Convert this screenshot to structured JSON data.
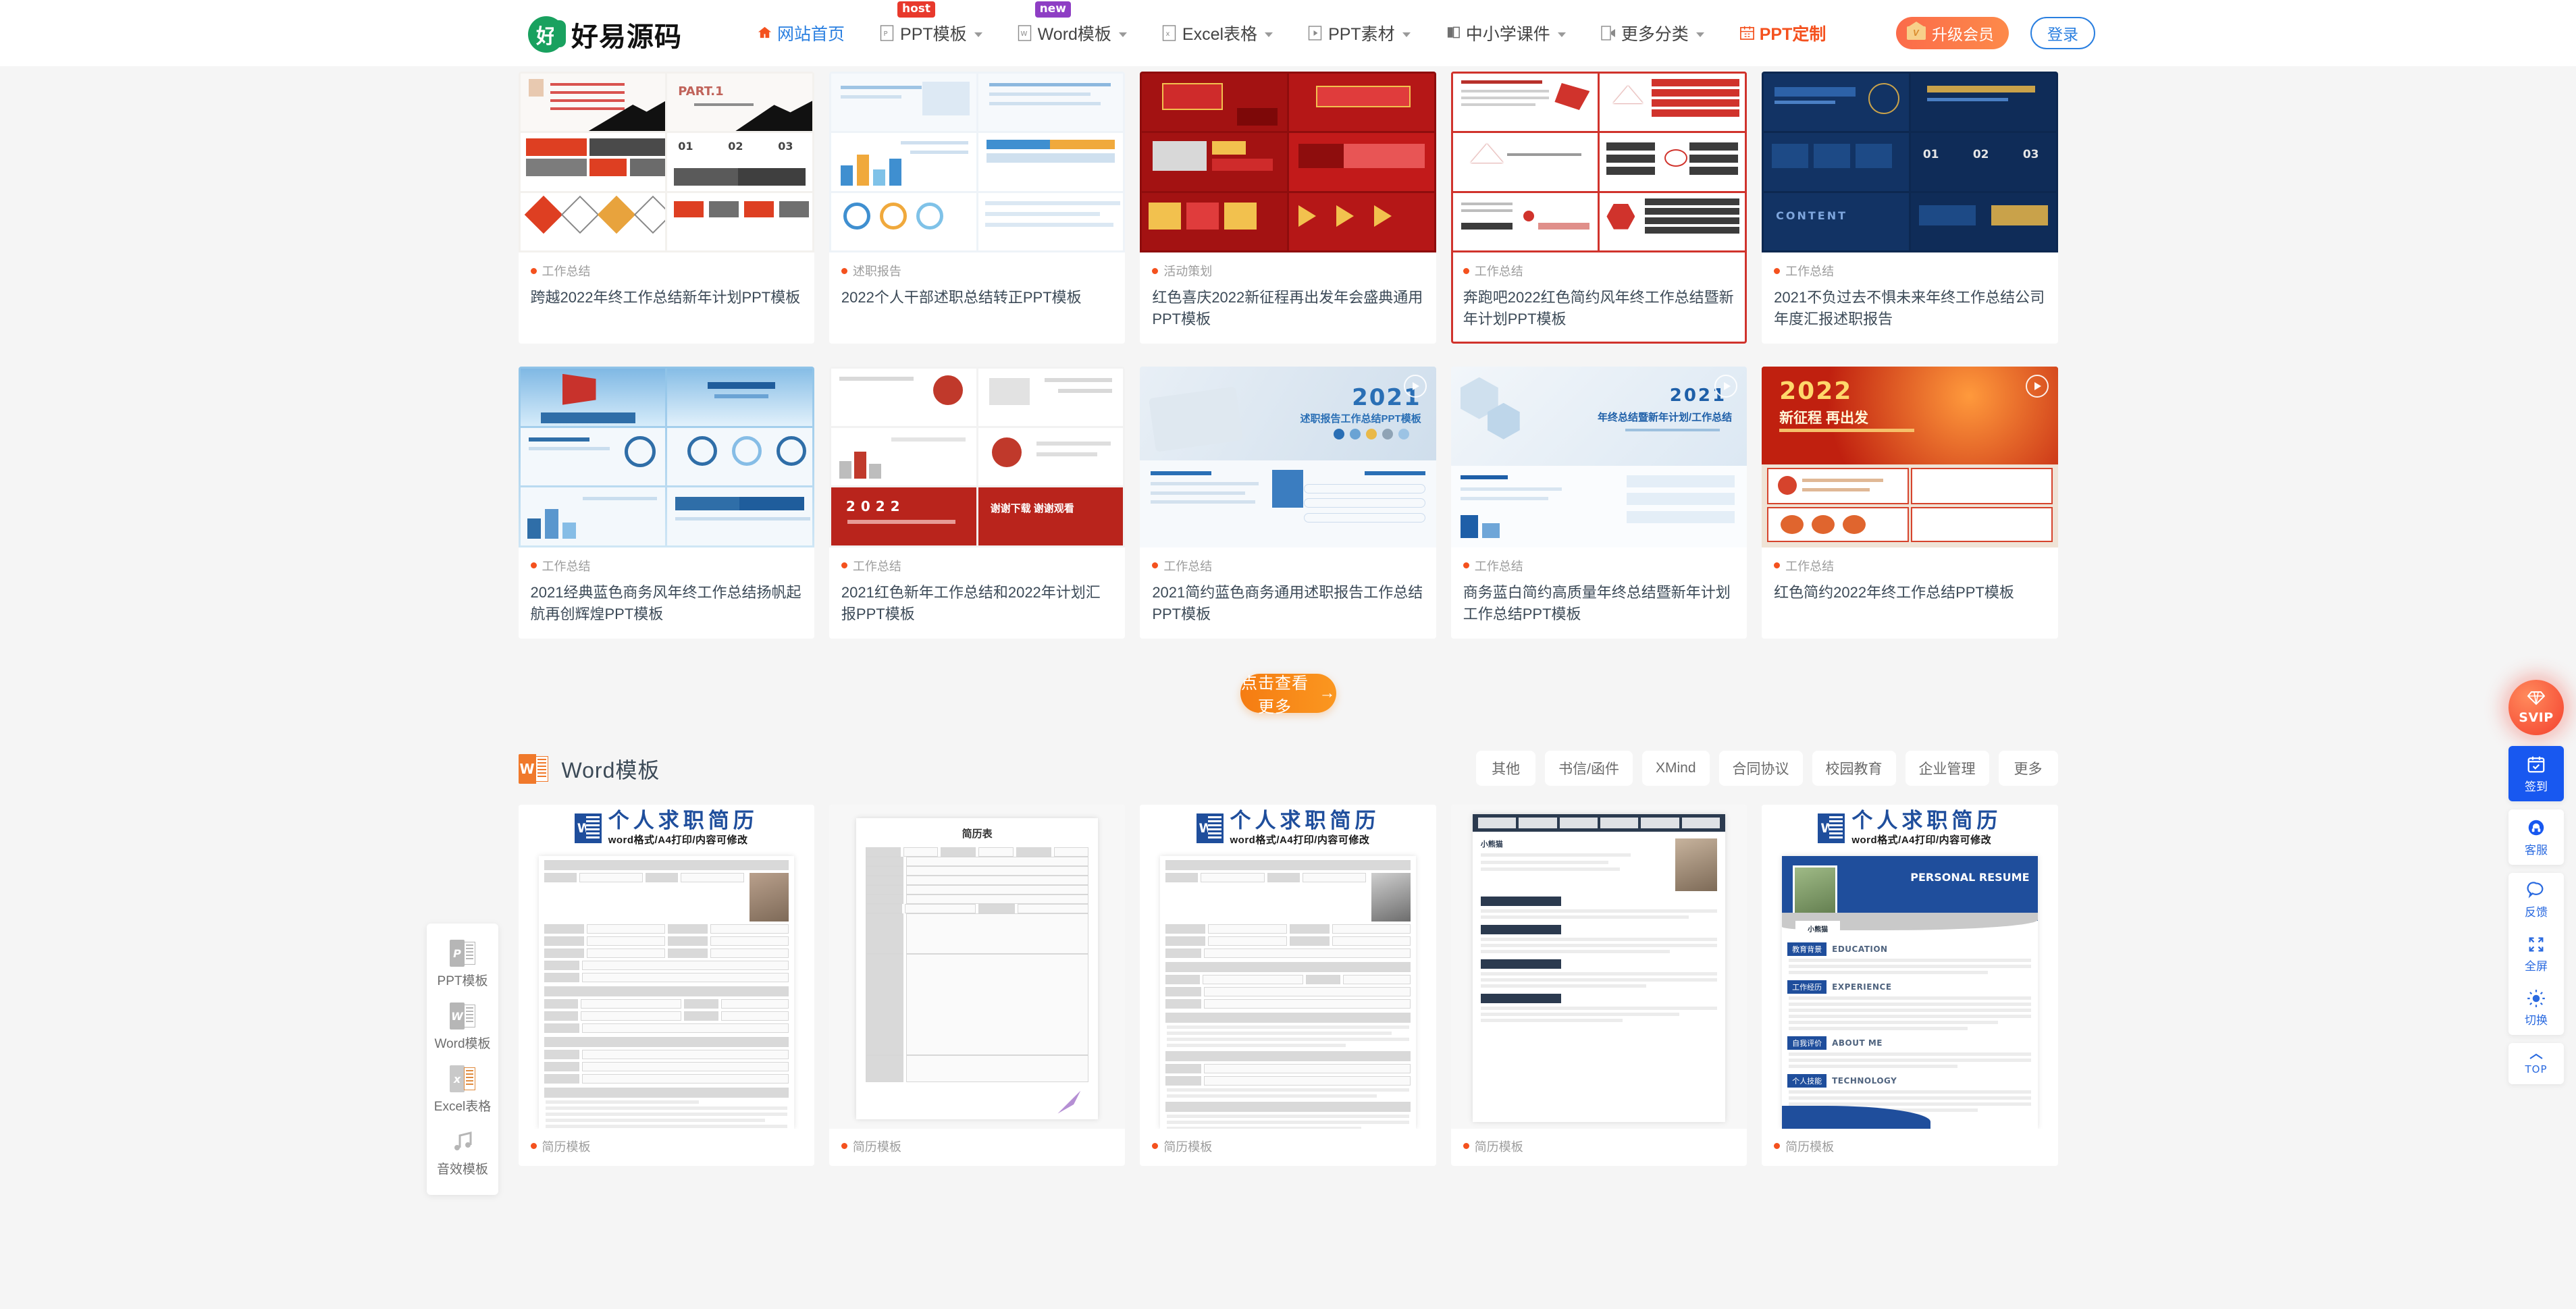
{
  "header": {
    "logo_text": "好易源码",
    "logo_mark": "logo-icon",
    "nav": [
      {
        "label": "网站首页",
        "icon": "home-icon",
        "badge": null,
        "caret": false,
        "active": true,
        "accent": false
      },
      {
        "label": "PPT模板",
        "icon": "ppt-file-icon",
        "badge": "host",
        "badge_type": "host",
        "caret": true,
        "active": false,
        "accent": false
      },
      {
        "label": "Word模板",
        "icon": "word-file-icon",
        "badge": "new",
        "badge_type": "new",
        "caret": true,
        "active": false,
        "accent": false
      },
      {
        "label": "Excel表格",
        "icon": "excel-file-icon",
        "badge": null,
        "caret": true,
        "active": false,
        "accent": false
      },
      {
        "label": "PPT素材",
        "icon": "media-file-icon",
        "badge": null,
        "caret": true,
        "active": false,
        "accent": false
      },
      {
        "label": "中小学课件",
        "icon": "book-icon",
        "badge": null,
        "caret": true,
        "active": false,
        "accent": false
      },
      {
        "label": "更多分类",
        "icon": "more-file-icon",
        "badge": null,
        "caret": true,
        "active": false,
        "accent": false
      },
      {
        "label": "PPT定制",
        "icon": "calendar-icon",
        "badge": null,
        "caret": false,
        "active": false,
        "accent": true
      }
    ],
    "vip_button": "升级会员",
    "vip_icon": "crown-icon",
    "login_button": "登录"
  },
  "ppt_section": {
    "row1": [
      {
        "tag": "工作总结",
        "title": "跨越2022年终工作总结新年计划PPT模板",
        "style": "redgray",
        "selected": false,
        "play": false
      },
      {
        "tag": "述职报告",
        "title": "2022个人干部述职总结转正PPT模板",
        "style": "lightblue",
        "selected": false,
        "play": false
      },
      {
        "tag": "活动策划",
        "title": "红色喜庆2022新征程再出发年会盛典通用PPT模板",
        "style": "red",
        "selected": false,
        "play": false
      },
      {
        "tag": "工作总结",
        "title": "奔跑吧2022红色简约风年终工作总结暨新年计划PPT模板",
        "style": "redline",
        "selected": true,
        "play": false
      },
      {
        "tag": "工作总结",
        "title": "2021不负过去不惧未来年终工作总结公司年度汇报述职报告",
        "style": "darkblue",
        "selected": false,
        "play": false
      }
    ],
    "row2": [
      {
        "tag": "工作总结",
        "title": "2021经典蓝色商务风年终工作总结扬帆起航再创辉煌PPT模板",
        "style": "sea",
        "selected": false,
        "play": false
      },
      {
        "tag": "工作总结",
        "title": "2021红色新年工作总结和2022年计划汇报PPT模板",
        "style": "whitered",
        "selected": false,
        "play": false
      },
      {
        "tag": "工作总结",
        "title": "2021简约蓝色商务通用述职报告工作总结PPT模板",
        "style": "bluehand",
        "selected": false,
        "play": true
      },
      {
        "tag": "工作总结",
        "title": "商务蓝白简约高质量年终总结暨新年计划工作总结PPT模板",
        "style": "bluehex",
        "selected": false,
        "play": true
      },
      {
        "tag": "工作总结",
        "title": "红色简约2022年终工作总结PPT模板",
        "style": "redcity",
        "selected": false,
        "play": true
      }
    ],
    "more_button": "点击查看更多",
    "more_arrow": "→"
  },
  "word_section": {
    "icon": "word-app-icon",
    "title": "Word模板",
    "chips": [
      "其他",
      "书信/函件",
      "XMind",
      "合同协议",
      "校园教育",
      "企业管理",
      "更多"
    ],
    "cards": [
      {
        "tag": "简历模板",
        "heading": "个人求职简历",
        "sub": "word格式/A4打印/内容可修改",
        "style": "table-gray"
      },
      {
        "tag": "简历模板",
        "heading": "简历表",
        "sub": "",
        "style": "plain-form"
      },
      {
        "tag": "简历模板",
        "heading": "个人求职简历",
        "sub": "word格式/A4打印/内容可修改",
        "style": "table-photo"
      },
      {
        "tag": "简历模板",
        "heading": "",
        "sub": "",
        "style": "dark-top"
      },
      {
        "tag": "简历模板",
        "heading": "个人求职简历",
        "sub": "word格式/A4打印/内容可修改",
        "style": "blue-resume"
      }
    ],
    "resume_labels": {
      "personal_resume_en": "PERSONAL RESUME",
      "name": "小熊猫",
      "sections": [
        {
          "cn": "教育背景",
          "en": "EDUCATION"
        },
        {
          "cn": "工作经历",
          "en": "EXPERIENCE"
        },
        {
          "cn": "自我评价",
          "en": "ABOUT ME"
        },
        {
          "cn": "个人技能",
          "en": "TECHNOLOGY"
        }
      ]
    }
  },
  "left_nav": [
    {
      "label": "PPT模板",
      "icon": "ppt-app-icon",
      "color": "#9a9a9a"
    },
    {
      "label": "Word模板",
      "icon": "word-app-icon",
      "color": "#9a9a9a"
    },
    {
      "label": "Excel表格",
      "icon": "excel-app-icon",
      "color": "#e08a3c"
    },
    {
      "label": "音效模板",
      "icon": "music-note-icon",
      "color": "#9a9a9a"
    }
  ],
  "right_nav": {
    "svip": {
      "label": "SVIP",
      "icon": "diamond-icon"
    },
    "items": [
      {
        "label": "签到",
        "icon": "calendar-check-icon",
        "highlight": true
      },
      {
        "label": "客服",
        "icon": "headset-icon",
        "highlight": false
      },
      {
        "label": "反馈",
        "icon": "speech-bubble-icon",
        "highlight": false
      },
      {
        "label": "全屏",
        "icon": "expand-icon",
        "highlight": false
      },
      {
        "label": "切换",
        "icon": "sun-icon",
        "highlight": false
      }
    ],
    "top": {
      "label": "TOP",
      "icon": "chevron-up-icon"
    }
  }
}
